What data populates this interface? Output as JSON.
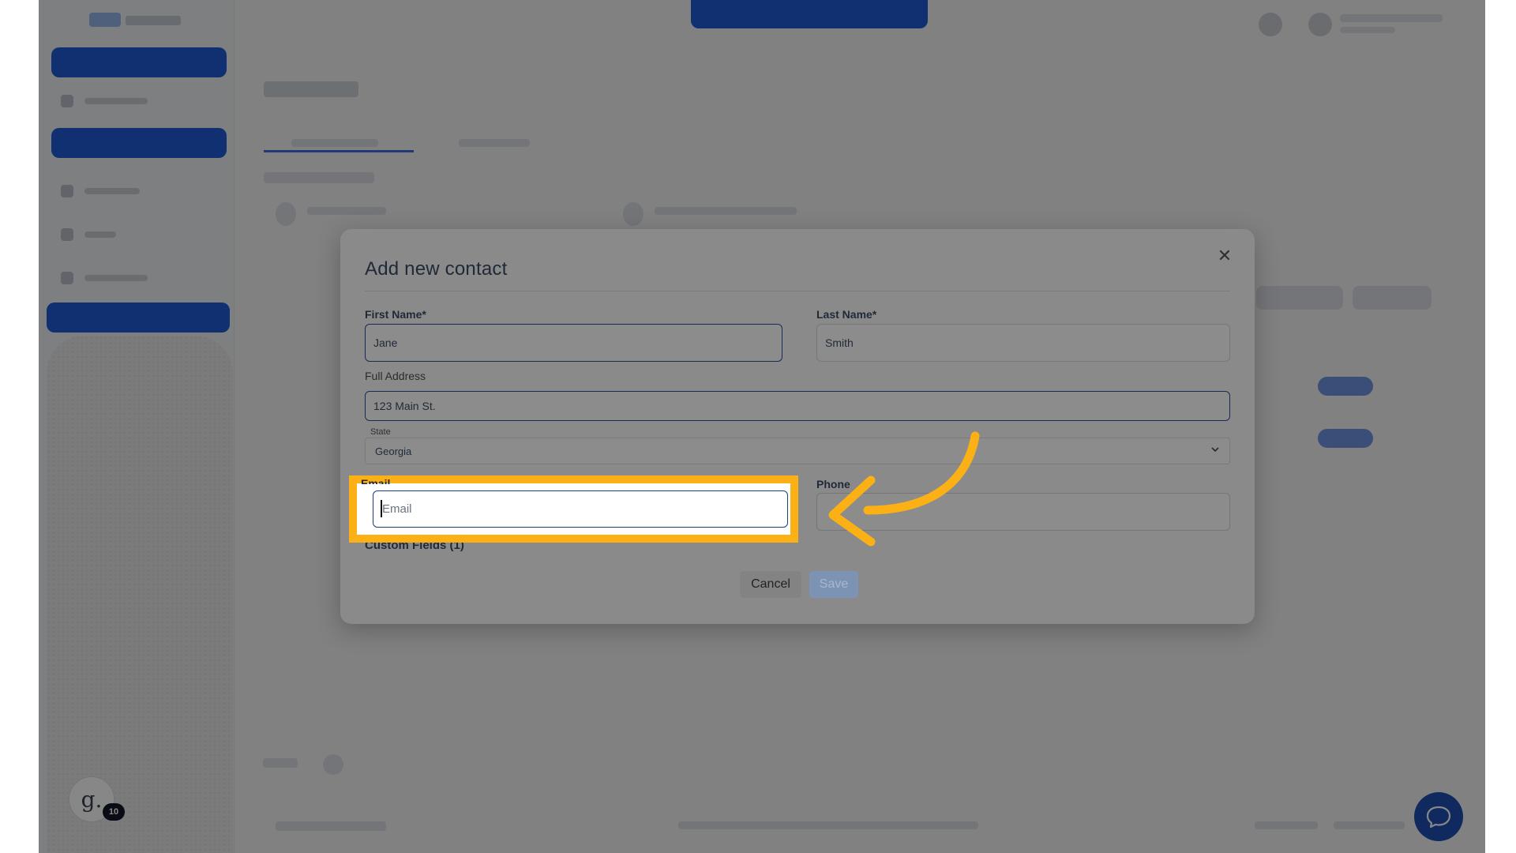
{
  "background_app": {
    "bubble_letter": "g.",
    "bubble_badge": "10"
  },
  "modal": {
    "title": "Add new contact",
    "close_glyph": "✕",
    "first_name": {
      "label": "First Name*",
      "value": "Jane"
    },
    "last_name": {
      "label": "Last Name*",
      "value": "Smith"
    },
    "address": {
      "label": "Full Address",
      "value": "123 Main St."
    },
    "state": {
      "label": "State",
      "value": "Georgia"
    },
    "email": {
      "label": "Email",
      "placeholder": "Email",
      "value": ""
    },
    "phone": {
      "label": "Phone",
      "value": ""
    },
    "custom_fields": "Custom Fields (1)",
    "cancel_label": "Cancel",
    "save_label": "Save"
  },
  "colors": {
    "highlight": "#fbb016",
    "accent": "#1f5bd6",
    "focus_border": "#1a3e7a"
  },
  "icons": {
    "close": "close-icon",
    "chevron": "chevron-down-icon",
    "chat": "chat-bubble-icon",
    "annotation_arrow": "curved-arrow-icon"
  }
}
